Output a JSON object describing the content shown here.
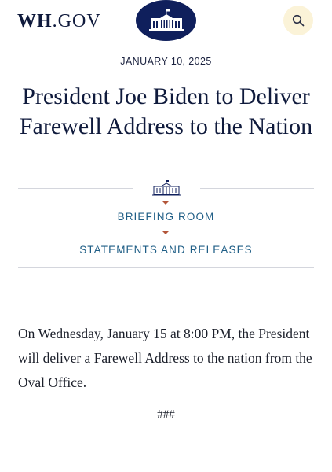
{
  "header": {
    "site_name_bold": "WH",
    "site_name_rest": ".GOV",
    "emblem_icon": "white-house-icon",
    "search_icon": "search-icon"
  },
  "article": {
    "date": "JANUARY 10, 2025",
    "title": "President Joe Biden to Deliver Farewell Address to the Nation",
    "category_primary": "BRIEFING ROOM",
    "category_secondary": "STATEMENTS AND RELEASES",
    "body": "On Wednesday, January 15 at 8:00 PM, the President will deliver a Farewell Address to the nation from the Oval Office.",
    "end_mark": "###"
  },
  "colors": {
    "navy": "#0f1f5c",
    "link_blue": "#1f5e86",
    "accent_red": "#b3563a",
    "search_bg": "#fbf3d8"
  }
}
